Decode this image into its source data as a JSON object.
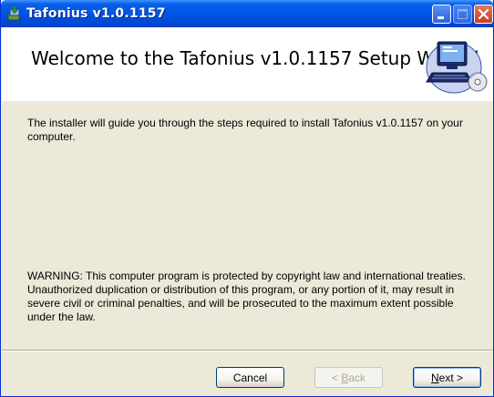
{
  "window": {
    "title": "Tafonius v1.0.1157"
  },
  "header": {
    "title": "Welcome to the Tafonius v1.0.1157 Setup Wizard",
    "logo_icon": "computer-cd-installer-icon"
  },
  "content": {
    "intro": "The installer will guide you through the steps required to install Tafonius v1.0.1157 on your computer.",
    "warning": "WARNING: This computer program is protected by copyright law and international treaties. Unauthorized duplication or distribution of this program, or any portion of it, may result in severe civil or criminal penalties, and will be prosecuted to the maximum extent possible under the law."
  },
  "buttons": {
    "cancel": "Cancel",
    "back_mnemonic": "B",
    "back_rest": "ack",
    "back_prefix": "< ",
    "next_mnemonic": "N",
    "next_rest": "ext >"
  },
  "colors": {
    "titlebar": "#0055e5",
    "dialog_bg": "#ece9d8",
    "header_bg": "#ffffff",
    "close_button": "#c8401f"
  }
}
